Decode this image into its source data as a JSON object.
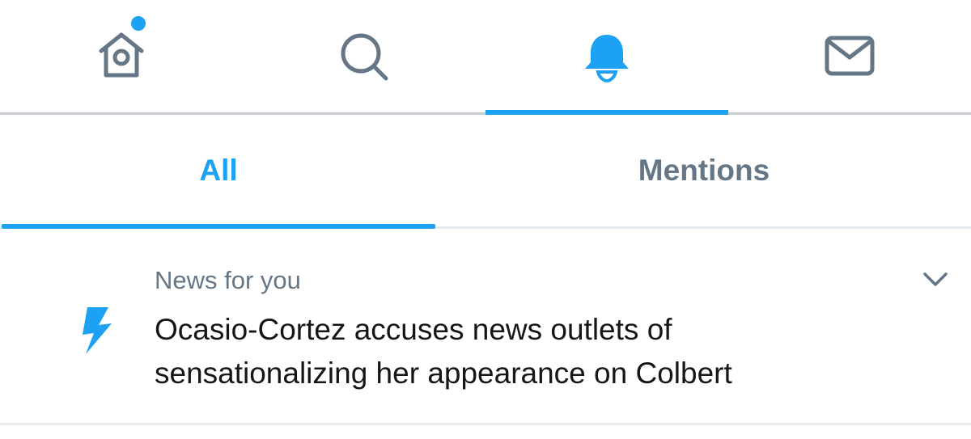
{
  "nav": {
    "items": [
      {
        "name": "home",
        "icon": "home-icon",
        "has_new_dot": true,
        "active": false
      },
      {
        "name": "search",
        "icon": "search-icon",
        "active": false
      },
      {
        "name": "notifications",
        "icon": "bell-icon",
        "active": true
      },
      {
        "name": "messages",
        "icon": "mail-icon",
        "active": false
      }
    ]
  },
  "tabs": {
    "all_label": "All",
    "mentions_label": "Mentions",
    "selected": "All"
  },
  "notification": {
    "icon": "lightning-bolt-icon",
    "kicker": "News for you",
    "headline": "Ocasio-Cortez accuses news outlets of sensationalizing her appearance on Colbert",
    "menu_icon": "chevron-down-icon"
  },
  "colors": {
    "accent": "#1da1f2",
    "secondary_text": "#657786",
    "primary_text": "#14171a",
    "icon_gray": "#657786",
    "divider": "#e6ecf0"
  }
}
